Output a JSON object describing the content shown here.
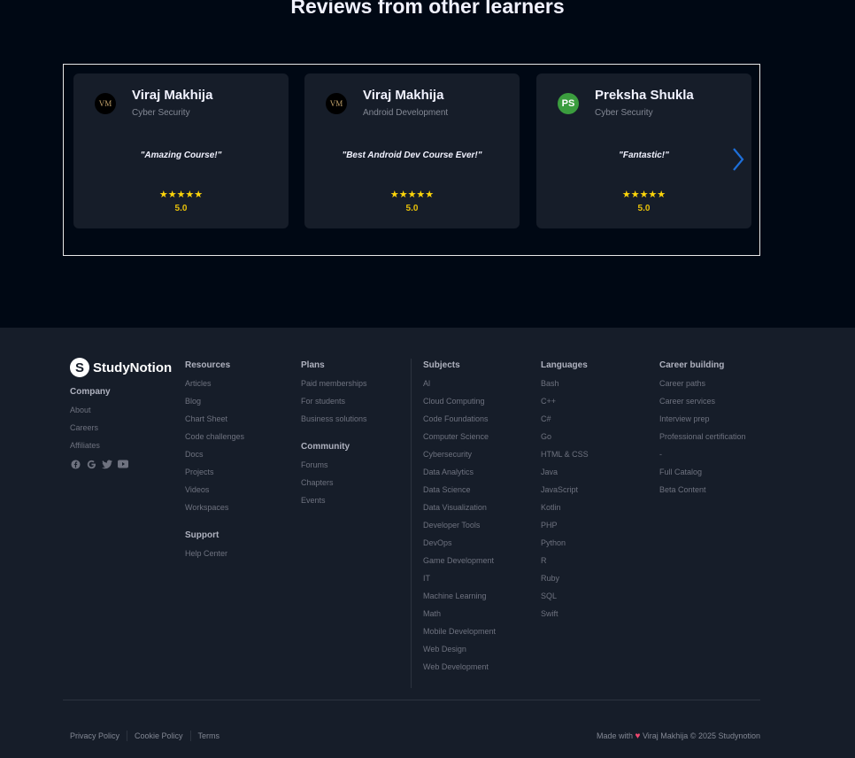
{
  "reviews": {
    "title": "Reviews from other learners",
    "cards": [
      {
        "initials": "VM",
        "name": "Viraj Makhija",
        "course": "Cyber Security",
        "text": "\"Amazing Course!\"",
        "stars": "★★★★★",
        "rating": "5.0"
      },
      {
        "initials": "VM",
        "name": "Viraj Makhija",
        "course": "Android Development",
        "text": "\"Best Android Dev Course Ever!\"",
        "stars": "★★★★★",
        "rating": "5.0"
      },
      {
        "initials": "PS",
        "name": "Preksha Shukla",
        "course": "Cyber Security",
        "text": "\"Fantastic!\"",
        "stars": "★★★★★",
        "rating": "5.0"
      }
    ]
  },
  "footer": {
    "brand": "StudyNotion",
    "company": {
      "heading": "Company",
      "links": [
        "About",
        "Careers",
        "Affiliates"
      ]
    },
    "social_icons": [
      "facebook-icon",
      "google-icon",
      "twitter-icon",
      "youtube-icon"
    ],
    "resources": {
      "heading": "Resources",
      "links": [
        "Articles",
        "Blog",
        "Chart Sheet",
        "Code challenges",
        "Docs",
        "Projects",
        "Videos",
        "Workspaces"
      ]
    },
    "support": {
      "heading": "Support",
      "links": [
        "Help Center"
      ]
    },
    "plans": {
      "heading": "Plans",
      "links": [
        "Paid memberships",
        "For students",
        "Business solutions"
      ]
    },
    "community": {
      "heading": "Community",
      "links": [
        "Forums",
        "Chapters",
        "Events"
      ]
    },
    "subjects": {
      "heading": "Subjects",
      "links": [
        "Al",
        "Cloud Computing",
        "Code Foundations",
        "Computer Science",
        "Cybersecurity",
        "Data Analytics",
        "Data Science",
        "Data Visualization",
        "Developer Tools",
        "DevOps",
        "Game Development",
        "IT",
        "Machine Learning",
        "Math",
        "Mobile Development",
        "Web Design",
        "Web Development"
      ]
    },
    "languages": {
      "heading": "Languages",
      "links": [
        "Bash",
        "C++",
        "C#",
        "Go",
        "HTML & CSS",
        "Java",
        "JavaScript",
        "Kotlin",
        "PHP",
        "Python",
        "R",
        "Ruby",
        "SQL",
        "Swift"
      ]
    },
    "career": {
      "heading": "Career building",
      "links": [
        "Career paths",
        "Career services",
        "Interview prep",
        "Professional certification",
        "-",
        "Full Catalog",
        "Beta Content"
      ]
    },
    "bottom_links": [
      "Privacy Policy",
      "Cookie Policy",
      "Terms"
    ],
    "made_with": "Made with",
    "copyright": "Viraj Makhija © 2025 Studynotion"
  },
  "colors": {
    "accent_arrow": "#1e6fd9",
    "star": "#ffd60a",
    "bg": "#000814",
    "footer_bg": "#161d29"
  }
}
